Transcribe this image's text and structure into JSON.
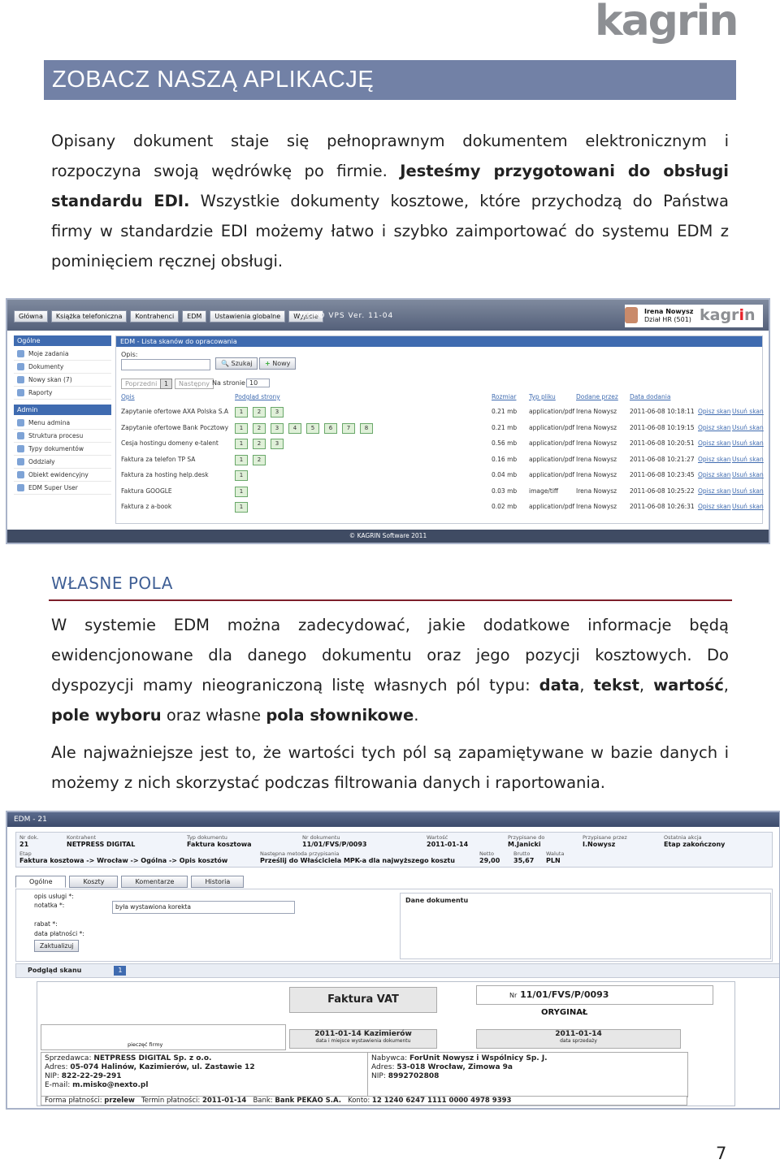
{
  "brand": {
    "logo": "kagrin"
  },
  "banner": {
    "title": "ZOBACZ NASZĄ APLIKACJĘ"
  },
  "intro": {
    "part1": "Opisany dokument staje się pełnoprawnym dokumentem elektronicznym i rozpoczyna swoją wędrówkę po firmie. ",
    "bold": "Jesteśmy przygotowani do obsługi standardu EDI.",
    "part2": " Wszystkie dokumenty kosztowe, które przychodzą do Państwa firmy w standardzie EDI możemy łatwo i szybko zaimportować do systemu EDM z pominięciem ręcznej obsługi."
  },
  "section": {
    "title": "WŁASNE POLA"
  },
  "para2": {
    "t1": "W systemie EDM można zadecydować, jakie dodatkowe informacje będą ewidencjonowane dla danego dokumentu oraz jego pozycji kosztowych. Do dyspozycji mamy nieograniczoną listę własnych pól typu: ",
    "b1": "data",
    "c1": ", ",
    "b2": "tekst",
    "c2": ", ",
    "b3": "wartość",
    "c3": ", ",
    "b4": "pole wyboru",
    "t2": " oraz własne ",
    "b5": "pola słownikowe",
    "t3": "."
  },
  "para3": {
    "text": "Ale najważniejsze jest to, że wartości tych pól są zapamiętywane w bazie danych i możemy z nich skorzystać podczas filtrowania danych i raportowania."
  },
  "page_number": "7",
  "screenshot1": {
    "nav": [
      "Główna",
      "Książka telefoniczna",
      "Kontrahenci",
      "EDM",
      "Ustawienia globalne",
      "Wyjście"
    ],
    "version": "DEMO VPS Ver. 11-04",
    "user_name": "Irena Nowysz",
    "user_dept": "Dział HR (501)",
    "sidebar_general": "Ogólne",
    "sidebar_general_items": [
      "Moje zadania",
      "Dokumenty",
      "Nowy skan (7)",
      "Raporty"
    ],
    "sidebar_admin": "Admin",
    "sidebar_admin_items": [
      "Menu admina",
      "Struktura procesu",
      "Typy dokumentów",
      "Oddziały",
      "Obiekt ewidencyjny",
      "EDM Super User"
    ],
    "panel_title": "EDM - Lista skanów do opracowania",
    "search_label": "Opis:",
    "search_button": "Szukaj",
    "new_button": "Nowy",
    "prev": "Poprzedni",
    "current_page": "1",
    "next": "Następny",
    "per_page_label": "Na stronie",
    "per_page": "10",
    "columns": [
      "Opis",
      "Podgląd strony",
      "Rozmiar",
      "Typ pliku",
      "Dodane przez",
      "Data dodania"
    ],
    "rows": [
      {
        "desc": "Zapytanie ofertowe AXA Polska S.A",
        "pages": [
          "1",
          "2",
          "3"
        ],
        "size": "0.21 mb",
        "type": "application/pdf",
        "by": "Irena Nowysz",
        "date": "2011-06-08 10:18:11"
      },
      {
        "desc": "Zapytanie ofertowe Bank Pocztowy",
        "pages": [
          "1",
          "2",
          "3",
          "4",
          "5",
          "6",
          "7",
          "8"
        ],
        "size": "0.21 mb",
        "type": "application/pdf",
        "by": "Irena Nowysz",
        "date": "2011-06-08 10:19:15"
      },
      {
        "desc": "Cesja hostingu domeny e-talent",
        "pages": [
          "1",
          "2",
          "3"
        ],
        "size": "0.56 mb",
        "type": "application/pdf",
        "by": "Irena Nowysz",
        "date": "2011-06-08 10:20:51"
      },
      {
        "desc": "Faktura za telefon TP SA",
        "pages": [
          "1",
          "2"
        ],
        "size": "0.16 mb",
        "type": "application/pdf",
        "by": "Irena Nowysz",
        "date": "2011-06-08 10:21:27"
      },
      {
        "desc": "Faktura za hosting help.desk",
        "pages": [
          "1"
        ],
        "size": "0.04 mb",
        "type": "application/pdf",
        "by": "Irena Nowysz",
        "date": "2011-06-08 10:23:45"
      },
      {
        "desc": "Faktura GOOGLE",
        "pages": [
          "1"
        ],
        "size": "0.03 mb",
        "type": "image/tiff",
        "by": "Irena Nowysz",
        "date": "2011-06-08 10:25:22"
      },
      {
        "desc": "Faktura z a-book",
        "pages": [
          "1"
        ],
        "size": "0.02 mb",
        "type": "application/pdf",
        "by": "Irena Nowysz",
        "date": "2011-06-08 10:26:31"
      }
    ],
    "action_describe": "Opisz skan",
    "action_delete": "Usuń skan",
    "footer": "© KAGRIN Software 2011"
  },
  "screenshot2": {
    "title": "EDM - 21",
    "info": [
      {
        "label": "Nr dok.",
        "value": "21"
      },
      {
        "label": "Kontrahent",
        "value": "NETPRESS DIGITAL"
      },
      {
        "label": "Typ dokumentu",
        "value": "Faktura kosztowa"
      },
      {
        "label": "Nr dokumentu",
        "value": "11/01/FVS/P/0093"
      },
      {
        "label": "Wartość",
        "value": "2011-01-14"
      },
      {
        "label": "Przypisane do",
        "value": "M.Janicki"
      },
      {
        "label": "Przypisane przez",
        "value": "I.Nowysz"
      },
      {
        "label": "Ostatnia akcja",
        "value": "Etap zakończony"
      }
    ],
    "info2": [
      {
        "label": "Etap",
        "value": "Faktura kosztowa -> Wrocław -> Ogólna -> Opis kosztów"
      },
      {
        "label": "Następna metoda przypisania",
        "value": "Prześlij do Właściciela MPK-a dla najwyższego kosztu"
      },
      {
        "label": "Netto",
        "value": "29,00"
      },
      {
        "label": "Brutto",
        "value": "35,67"
      },
      {
        "label": "Waluta",
        "value": "PLN"
      }
    ],
    "tabs": [
      "Ogólne",
      "Koszty",
      "Komentarze",
      "Historia"
    ],
    "form": {
      "label1": "opis usługi *:",
      "label2": "notatka *:",
      "note_value": "była wystawiona korekta",
      "label3": "rabat *:",
      "label4": "data płatności *:",
      "update_button": "Zaktualizuj",
      "pane_title": "Dane dokumentu"
    },
    "preview_label": "Podgląd skanu",
    "preview_page": "1",
    "invoice": {
      "title": "Faktura VAT",
      "number_label": "Nr",
      "number": "11/01/FVS/P/0093",
      "original": "ORYGINAŁ",
      "stamp": "pieczęć firmy",
      "date_place": "2011-01-14  Kazimierów",
      "date_place_label": "data i miejsce wystawienia dokumentu",
      "sale_date": "2011-01-14",
      "sale_date_label": "data sprzedaży",
      "seller_label": "Sprzedawca:",
      "seller": "NETPRESS DIGITAL Sp. z o.o.",
      "seller_addr_label": "Adres:",
      "seller_addr": "05-074 Halinów, Kazimierów, ul. Zastawie 12",
      "seller_nip_label": "NIP:",
      "seller_nip": "822-22-29-291",
      "seller_email_label": "E-mail:",
      "seller_email": "m.misko@nexto.pl",
      "buyer_label": "Nabywca:",
      "buyer": "ForUnit Nowysz i Wspólnicy Sp. J.",
      "buyer_addr_label": "Adres:",
      "buyer_addr": "53-018 Wrocław, Zimowa 9a",
      "buyer_nip_label": "NIP:",
      "buyer_nip": "8992702808",
      "payment_form_label": "Forma płatności:",
      "payment_form": "przelew",
      "payment_due_label": "Termin płatności:",
      "payment_due": "2011-01-14",
      "bank_label": "Bank:",
      "bank": "Bank PEKAO S.A.",
      "account_label": "Konto:",
      "account": "12 1240 6247 1111 0000 4978 9393"
    }
  }
}
